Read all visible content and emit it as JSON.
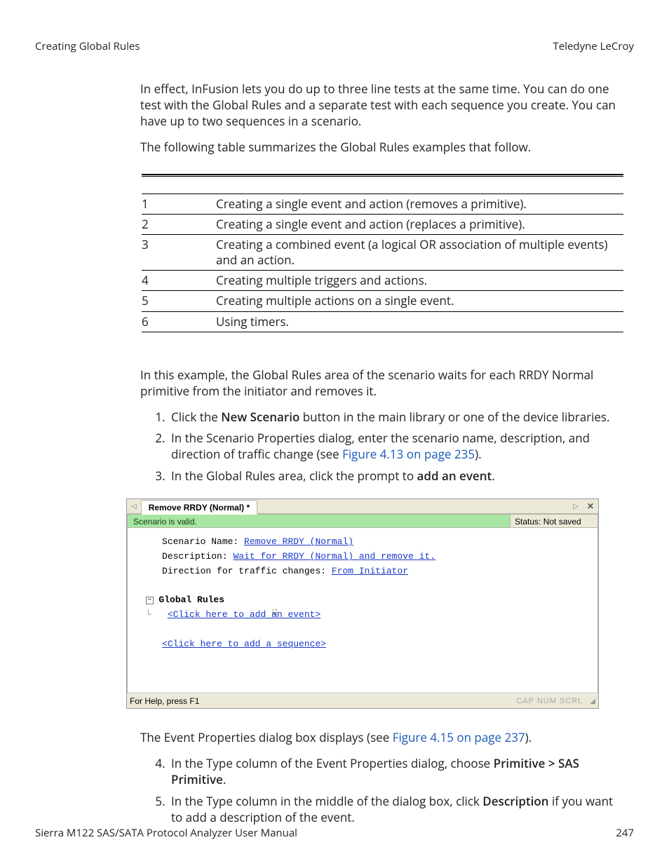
{
  "header": {
    "left": "Creating Global Rules",
    "right": "Teledyne LeCroy"
  },
  "intro": {
    "p1": "In effect, InFusion lets you do up to three line tests at the same time. You can do one test with the Global Rules and a separate test with each sequence you create. You can have up to two sequences in a scenario.",
    "p2": "The following table summarizes the Global Rules examples that follow."
  },
  "table": {
    "rows": [
      {
        "n": "1",
        "desc": "Creating a single event and action (removes a primitive)."
      },
      {
        "n": "2",
        "desc": "Creating a single event and action (replaces a primitive)."
      },
      {
        "n": "3",
        "desc": "Creating a combined event (a logical OR association of multiple events) and an action."
      },
      {
        "n": "4",
        "desc": "Creating multiple triggers and actions."
      },
      {
        "n": "5",
        "desc": "Creating multiple actions on a single event."
      },
      {
        "n": "6",
        "desc": "Using timers."
      }
    ]
  },
  "example": {
    "intro": "In this example, the Global Rules area of the scenario waits for each RRDY Normal primitive from the initiator and removes it.",
    "step1_pre": "Click the ",
    "step1_bold": "New Scenario",
    "step1_post": " button in the main library or one of the device libraries.",
    "step2_pre": "In the Scenario Properties dialog, enter the scenario name, description, and direction of traffic change (see ",
    "step2_link": "Figure 4.13 on page 235",
    "step2_post": ").",
    "step3_pre": "In the Global Rules area, click the prompt to ",
    "step3_bold": "add an event",
    "step3_post": "."
  },
  "app": {
    "tab_title": "Remove RRDY (Normal) *",
    "valid_msg": "Scenario is valid.",
    "status_msg": "Status: Not saved",
    "scn_name_label": "Scenario Name: ",
    "scn_name_value": "Remove RRDY (Normal)",
    "desc_label": "Description: ",
    "desc_value": "Wait for RRDY (Normal) and remove it.",
    "dir_label": "Direction for traffic changes: ",
    "dir_value": "From Initiator",
    "global_rules_label": "Global Rules",
    "add_event_prompt": "<Click here to add an event>",
    "add_seq_prompt": "<Click here to add a sequence>",
    "statusbar_help": "For Help, press F1",
    "statusbar_indicators": "CAP NUM SCRL"
  },
  "after": {
    "p1_pre": "The Event Properties dialog box displays (see ",
    "p1_link": "Figure 4.15 on page 237",
    "p1_post": ").",
    "step4_pre": "In the Type column of the Event Properties dialog, choose ",
    "step4_bold": "Primitive > SAS Primitive",
    "step4_post": ".",
    "step5_pre": "In the Type column in the middle of the dialog box, click ",
    "step5_bold": "Description",
    "step5_post": " if you want to add a description of the event."
  },
  "footer": {
    "manual": "Sierra M122 SAS/SATA Protocol Analyzer User Manual",
    "page": "247"
  }
}
